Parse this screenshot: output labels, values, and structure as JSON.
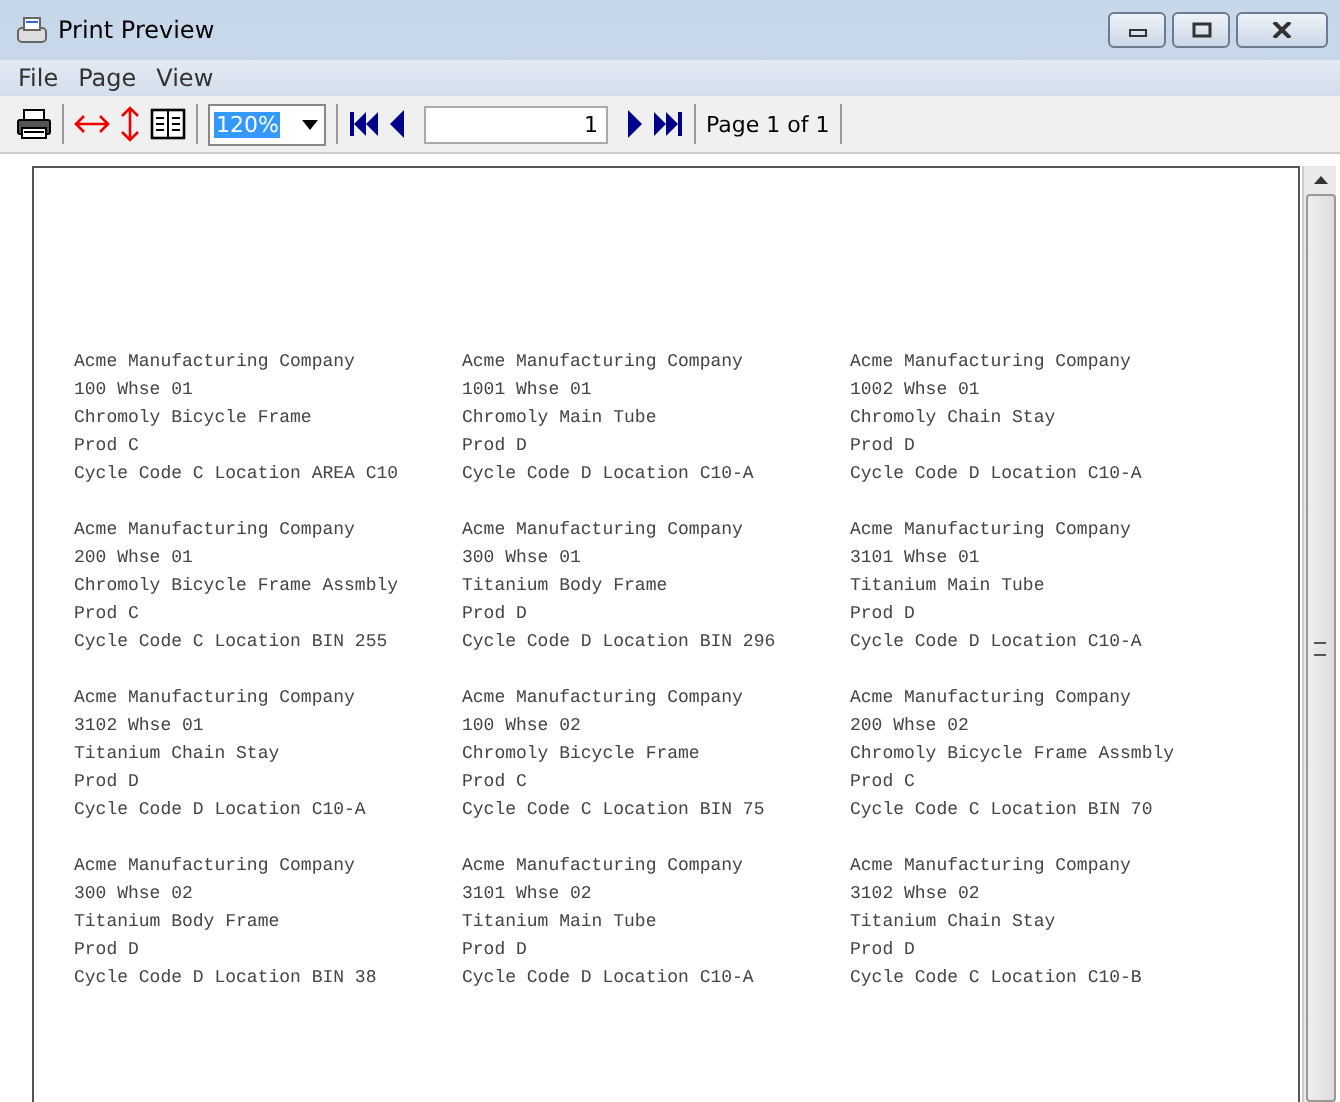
{
  "window": {
    "title": "Print Preview"
  },
  "menu": [
    "File",
    "Page",
    "View"
  ],
  "toolbar": {
    "zoom": "120%",
    "page_field": "1",
    "page_status": "Page 1 of 1"
  },
  "labels": [
    [
      "Acme Manufacturing Company",
      "100 Whse 01",
      "Chromoly Bicycle Frame",
      "Prod C",
      "Cycle Code C Location AREA C10"
    ],
    [
      "Acme Manufacturing Company",
      "1001 Whse 01",
      "Chromoly Main Tube",
      "Prod D",
      "Cycle Code D Location C10-A"
    ],
    [
      "Acme Manufacturing Company",
      "1002 Whse 01",
      "Chromoly Chain Stay",
      "Prod D",
      "Cycle Code D Location C10-A"
    ],
    [
      "Acme Manufacturing Company",
      "200 Whse 01",
      "Chromoly Bicycle Frame Assmbly",
      "Prod C",
      "Cycle Code C Location BIN 255"
    ],
    [
      "Acme Manufacturing Company",
      "300 Whse 01",
      "Titanium Body Frame",
      "Prod D",
      "Cycle Code D Location BIN 296"
    ],
    [
      "Acme Manufacturing Company",
      "3101 Whse 01",
      "Titanium Main Tube",
      "Prod D",
      "Cycle Code D Location C10-A"
    ],
    [
      "Acme Manufacturing Company",
      "3102 Whse 01",
      "Titanium Chain Stay",
      "Prod D",
      "Cycle Code D Location C10-A"
    ],
    [
      "Acme Manufacturing Company",
      "100 Whse 02",
      "Chromoly Bicycle Frame",
      "Prod C",
      "Cycle Code C Location BIN 75"
    ],
    [
      "Acme Manufacturing Company",
      "200 Whse 02",
      "Chromoly Bicycle Frame Assmbly",
      "Prod C",
      "Cycle Code C Location BIN 70"
    ],
    [
      "Acme Manufacturing Company",
      "300 Whse 02",
      "Titanium Body Frame",
      "Prod D",
      "Cycle Code D Location BIN 38"
    ],
    [
      "Acme Manufacturing Company",
      "3101 Whse 02",
      "Titanium Main Tube",
      "Prod D",
      "Cycle Code D Location C10-A"
    ],
    [
      "Acme Manufacturing Company",
      "3102 Whse 02",
      "Titanium Chain Stay",
      "Prod D",
      "Cycle Code C Location C10-B"
    ]
  ]
}
